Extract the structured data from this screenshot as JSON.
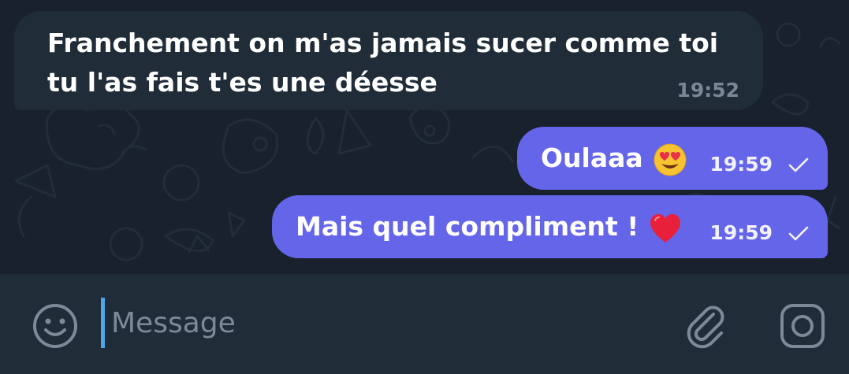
{
  "colors": {
    "background": "#18212c",
    "incoming_bubble": "#212c39",
    "outgoing_bubble": "#6565ea",
    "composer": "#212c39",
    "cursor": "#4ca6e8",
    "icon": "#7c8a98"
  },
  "messages": [
    {
      "direction": "incoming",
      "text": "Franchement on m'as jamais sucer comme toi tu l'as fais t'es une déesse",
      "time": "19:52"
    },
    {
      "direction": "outgoing",
      "text": "Oulaaa",
      "emoji": "smiling-face-with-heart-eyes",
      "time": "19:59",
      "status": "sent"
    },
    {
      "direction": "outgoing",
      "text": "Mais quel compliment !",
      "emoji": "red-heart",
      "time": "19:59",
      "status": "sent"
    }
  ],
  "composer": {
    "placeholder": "Message",
    "icons": {
      "left": "emoji-icon",
      "attach": "paperclip-icon",
      "right": "camera-icon"
    }
  }
}
